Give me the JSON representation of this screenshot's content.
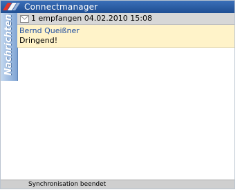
{
  "app": {
    "title": "Connectmanager"
  },
  "sidebar": {
    "label": "Nachrichten"
  },
  "message": {
    "header": "1 empfangen 04.02.2010 15:08",
    "sender": "Bernd Queißner",
    "subject": "Dringend!"
  },
  "status": {
    "text": "Synchronisation beendet"
  },
  "colors": {
    "titlebar": "#1f4e93",
    "sidebar": "#7fa4d4",
    "message_bg": "#fff3c9",
    "sender": "#1f4da0"
  },
  "icons": {
    "logo": "app-logo",
    "message": "envelope-icon"
  }
}
